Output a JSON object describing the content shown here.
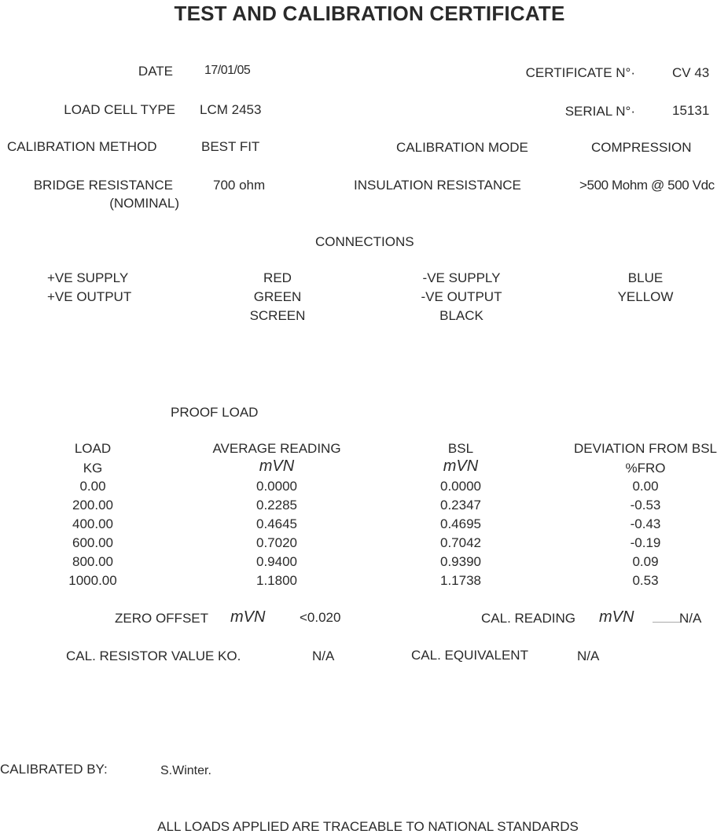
{
  "title": "TEST AND CALIBRATION CERTIFICATE",
  "header": {
    "date_label": "DATE",
    "date_value": "17/01/05",
    "certificate_label": "CERTIFICATE N°·",
    "certificate_value": "CV 43",
    "load_cell_type_label": "LOAD CELL TYPE",
    "load_cell_type_value": "LCM 2453",
    "serial_label": "SERIAL N°·",
    "serial_value": "15131",
    "calibration_method_label": "CALIBRATION METHOD",
    "calibration_method_value": "BEST FIT",
    "calibration_mode_label": "CALIBRATION MODE",
    "calibration_mode_value": "COMPRESSION",
    "bridge_resistance_label": "BRIDGE RESISTANCE",
    "bridge_resistance_sublabel": "(NOMINAL)",
    "bridge_resistance_value": "700 ohm",
    "insulation_resistance_label": "INSULATION RESISTANCE",
    "insulation_resistance_value": ">500 Mohm @ 500 Vdc"
  },
  "connections": {
    "title": "CONNECTIONS",
    "left_signals": [
      "+VE SUPPLY",
      "+VE OUTPUT"
    ],
    "left_colors": [
      "RED",
      "GREEN",
      "SCREEN"
    ],
    "right_signals": [
      "-VE SUPPLY",
      "-VE OUTPUT",
      "BLACK"
    ],
    "right_colors": [
      "BLUE",
      "YELLOW"
    ]
  },
  "proof_load": {
    "title": "PROOF LOAD",
    "columns": [
      {
        "header": "LOAD",
        "unit": "KG"
      },
      {
        "header": "AVERAGE READING",
        "unit": "mVN"
      },
      {
        "header": "BSL",
        "unit": "mVN"
      },
      {
        "header": "DEVIATION FROM BSL",
        "unit": "%FRO"
      }
    ],
    "rows": [
      [
        "0.00",
        "0.0000",
        "0.0000",
        "0.00"
      ],
      [
        "200.00",
        "0.2285",
        "0.2347",
        "-0.53"
      ],
      [
        "400.00",
        "0.4645",
        "0.4695",
        "-0.43"
      ],
      [
        "600.00",
        "0.7020",
        "0.7042",
        "-0.19"
      ],
      [
        "800.00",
        "0.9400",
        "0.9390",
        "0.09"
      ],
      [
        "1000.00",
        "1.1800",
        "1.1738",
        "0.53"
      ]
    ]
  },
  "footer_values": {
    "zero_offset_label": "ZERO OFFSET",
    "zero_offset_unit": "mVN",
    "zero_offset_value": "<0.020",
    "cal_reading_label": "CAL. READING",
    "cal_reading_unit": "mVN",
    "cal_reading_value": "N/A",
    "cal_resistor_label": "CAL. RESISTOR VALUE KO.",
    "cal_resistor_value": "N/A",
    "cal_equivalent_label": "CAL. EQUIVALENT",
    "cal_equivalent_value": "N/A"
  },
  "calibrated_by_label": "CALIBRATED BY:",
  "calibrated_by_value": "S.Winter.",
  "traceability_note": "ALL LOADS APPLIED ARE TRACEABLE TO NATIONAL STANDARDS"
}
